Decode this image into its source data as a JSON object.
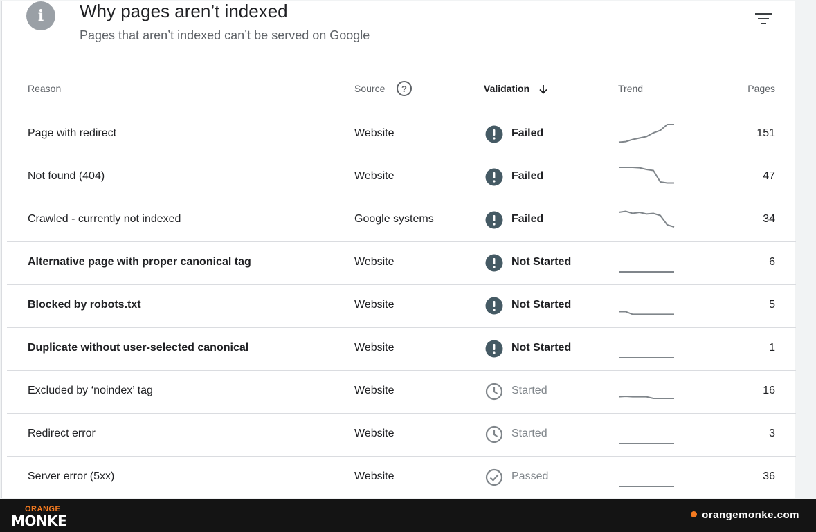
{
  "header": {
    "info_icon_glyph": "i",
    "title": "Why pages aren’t indexed",
    "subtitle": "Pages that aren’t indexed can’t be served on Google"
  },
  "table": {
    "columns": {
      "reason": "Reason",
      "source": "Source",
      "validation": "Validation",
      "trend": "Trend",
      "pages": "Pages"
    },
    "help_glyph": "?",
    "rows": [
      {
        "reason": "Page with redirect",
        "bold": false,
        "source": "Website",
        "status": "Failed",
        "status_type": "failed",
        "pages": "151",
        "trend": [
          0.15,
          0.18,
          0.28,
          0.35,
          0.42,
          0.6,
          0.72,
          1.0,
          1.0
        ]
      },
      {
        "reason": "Not found (404)",
        "bold": false,
        "source": "Website",
        "status": "Failed",
        "status_type": "failed",
        "pages": "47",
        "trend": [
          1.0,
          1.0,
          1.0,
          0.98,
          0.9,
          0.85,
          0.3,
          0.25,
          0.25
        ]
      },
      {
        "reason": "Crawled - currently not indexed",
        "bold": false,
        "source": "Google systems",
        "status": "Failed",
        "status_type": "failed",
        "pages": "34",
        "trend": [
          0.9,
          0.95,
          0.85,
          0.9,
          0.82,
          0.85,
          0.75,
          0.3,
          0.2
        ]
      },
      {
        "reason": "Alternative page with proper canonical tag",
        "bold": true,
        "source": "Website",
        "status": "Not Started",
        "status_type": "failed",
        "pages": "6",
        "trend": [
          0.1,
          0.1,
          0.1,
          0.1,
          0.1,
          0.1,
          0.1,
          0.1,
          0.1
        ]
      },
      {
        "reason": "Blocked by robots.txt",
        "bold": true,
        "source": "Website",
        "status": "Not Started",
        "status_type": "failed",
        "pages": "5",
        "trend": [
          0.25,
          0.25,
          0.12,
          0.12,
          0.12,
          0.12,
          0.12,
          0.12,
          0.12
        ]
      },
      {
        "reason": "Duplicate without user-selected canonical",
        "bold": true,
        "source": "Website",
        "status": "Not Started",
        "status_type": "failed",
        "pages": "1",
        "trend": [
          0.1,
          0.1,
          0.1,
          0.1,
          0.1,
          0.1,
          0.1,
          0.1,
          0.1
        ]
      },
      {
        "reason": "Excluded by ‘noindex’ tag",
        "bold": false,
        "source": "Website",
        "status": "Started",
        "status_type": "started",
        "pages": "16",
        "trend": [
          0.28,
          0.3,
          0.28,
          0.28,
          0.28,
          0.2,
          0.2,
          0.2,
          0.2
        ]
      },
      {
        "reason": "Redirect error",
        "bold": false,
        "source": "Website",
        "status": "Started",
        "status_type": "started",
        "pages": "3",
        "trend": [
          0.1,
          0.1,
          0.1,
          0.1,
          0.1,
          0.1,
          0.1,
          0.1,
          0.1
        ]
      },
      {
        "reason": "Server error (5xx)",
        "bold": false,
        "source": "Website",
        "status": "Passed",
        "status_type": "passed",
        "pages": "36",
        "trend": [
          0.1,
          0.1,
          0.1,
          0.1,
          0.1,
          0.1,
          0.1,
          0.1,
          0.1
        ]
      }
    ]
  },
  "footer": {
    "logo_top": "ORANGE",
    "logo_main": "MONKE",
    "site": "orangemonke.com"
  },
  "colors": {
    "failed_icon": "#455a64",
    "started_icon": "#80868b",
    "trend_line": "#80868b",
    "brand_orange": "#f47a20"
  }
}
